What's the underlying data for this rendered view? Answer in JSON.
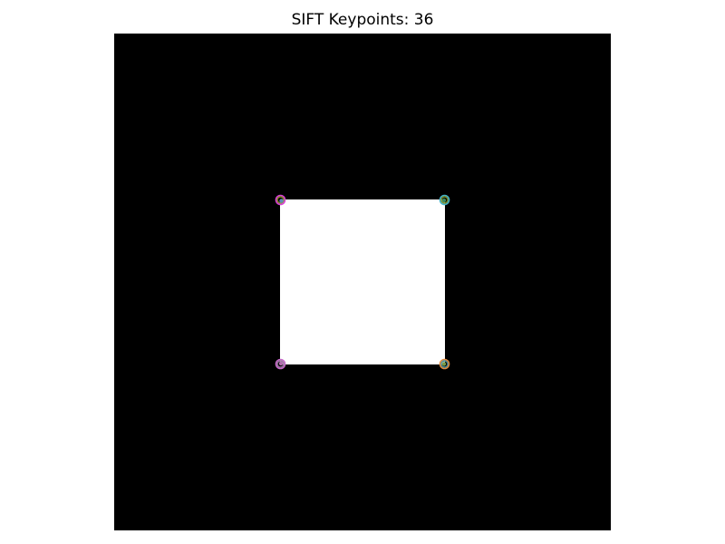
{
  "figure": {
    "title": "SIFT Keypoints: 36"
  },
  "image": {
    "background_color": "#000000",
    "square_color": "#ffffff"
  },
  "keypoints": {
    "visible_count": 4,
    "corners": [
      {
        "corner": "top-left",
        "colors": [
          "#d93fd9",
          "#8d8c2a",
          "#5b8fb8"
        ]
      },
      {
        "corner": "top-right",
        "colors": [
          "#42b2c8",
          "#7e8e2a",
          "#3b8a5c"
        ]
      },
      {
        "corner": "bottom-left",
        "colors": [
          "#c668c8",
          "#9a79a0",
          "#b46fb0"
        ]
      },
      {
        "corner": "bottom-right",
        "colors": [
          "#e08a3e",
          "#4e8f9c",
          "#7b9c46"
        ]
      }
    ]
  }
}
